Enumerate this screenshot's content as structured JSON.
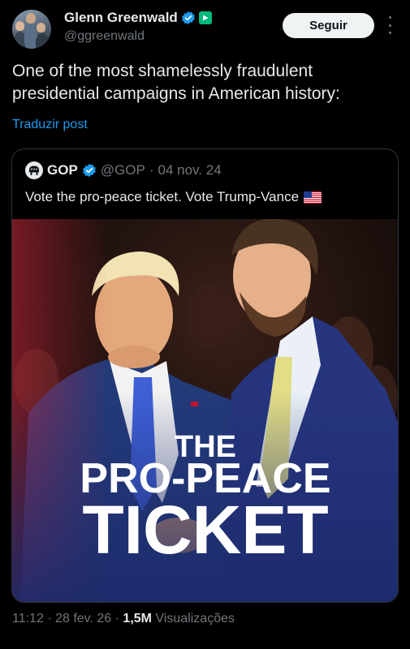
{
  "author": {
    "display_name": "Glenn Greenwald",
    "handle": "@ggreenwald",
    "avatar_icon": "avatar-photo",
    "verified_icon": "verified-badge-icon",
    "subscriber_icon": "subscriber-badge-icon"
  },
  "header": {
    "follow_label": "Seguir",
    "more_icon": "more-vertical-icon"
  },
  "post": {
    "text": "One of the most shamelessly fraudulent presidential campaigns in American history:",
    "translate_label": "Traduzir post"
  },
  "quoted_post": {
    "display_name": "GOP",
    "handle": "@GOP",
    "date": "04 nov. 24",
    "text": "Vote the pro-peace ticket. Vote Trump-Vance",
    "flag_icon": "us-flag-emoji",
    "image_caption": {
      "line1": "THE",
      "line2": "PRO-PEACE",
      "line3": "TICKET"
    }
  },
  "meta": {
    "time": "11:12",
    "date": "28 fev. 26",
    "views_count": "1,5M",
    "views_label": "Visualizações"
  },
  "colors": {
    "background": "#000000",
    "text_primary": "#e7e9ea",
    "text_secondary": "#71767b",
    "link": "#1d9bf0",
    "verified": "#1d9bf0",
    "subscriber": "#00ba7c",
    "follow_button_bg": "#eff3f4"
  }
}
